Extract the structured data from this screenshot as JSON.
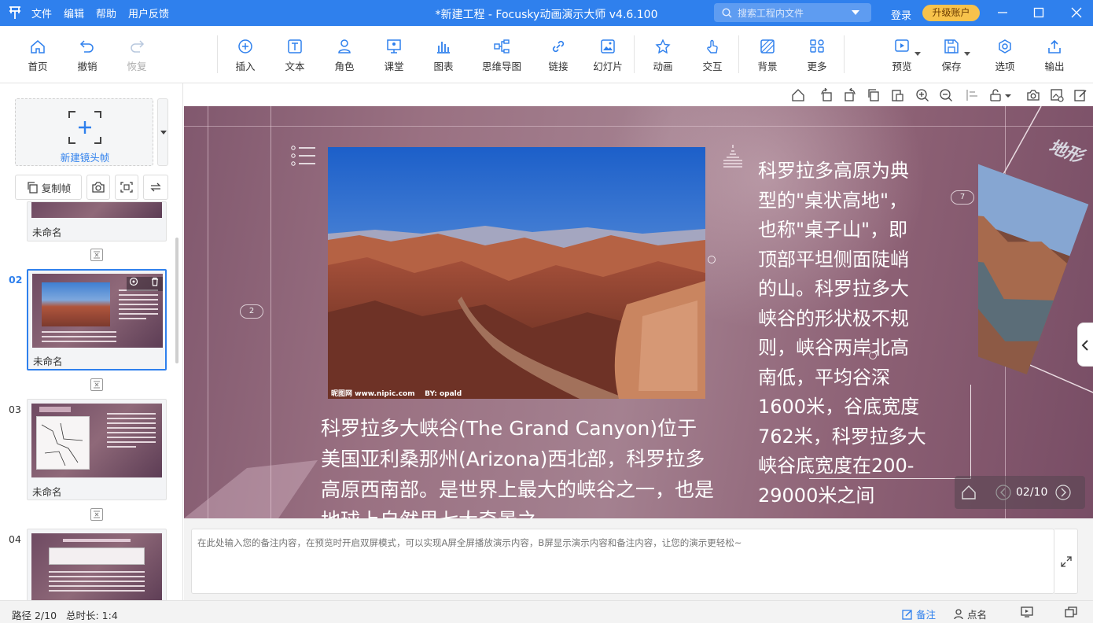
{
  "titlebar": {
    "menu": [
      "文件",
      "编辑",
      "帮助",
      "用户反馈"
    ],
    "title": "*新建工程 - Focusky动画演示大师  v4.6.100",
    "search_placeholder": "搜索工程内文件",
    "login": "登录",
    "upgrade": "升级账户",
    "accent": "#2f80ed"
  },
  "toolbar": {
    "home": "首页",
    "undo": "撤销",
    "redo": "恢复",
    "insert": "插入",
    "text": "文本",
    "role": "角色",
    "classroom": "课堂",
    "chart": "图表",
    "mindmap": "思维导图",
    "link": "链接",
    "slideshow": "幻灯片",
    "animation": "动画",
    "interact": "交互",
    "background": "背景",
    "more": "更多",
    "preview": "预览",
    "save": "保存",
    "options": "选项",
    "export": "输出"
  },
  "leftpanel": {
    "new_frame": "新建镜头帧",
    "copy_frame": "复制帧",
    "slides": [
      {
        "num": "",
        "name": "未命名"
      },
      {
        "num": "02",
        "name": "未命名",
        "selected": true
      },
      {
        "num": "03",
        "name": "未命名"
      },
      {
        "num": "04",
        "name": ""
      }
    ]
  },
  "stage": {
    "body_text": "科罗拉多大峡谷(The Grand Canyon)位于美国亚利桑那州(Arizona)西北部，科罗拉多高原西南部。是世界上最大的峡谷之一，也是地球上自然界七大奇景之",
    "side_text": "科罗拉多高原为典型的\"桌状高地\"，也称\"桌子山\"，即顶部平坦侧面陡峭的山。科罗拉多大峡谷的形状极不规则，峡谷两岸北高南低，平均谷深1600米，谷底宽度762米，科罗拉多大峡谷底宽度在200-29000米之间",
    "photo_watermark_site": "昵图网 www.nipic.com",
    "photo_watermark_by": "BY: opald",
    "frame_badge_left": "2",
    "frame_badge_right": "7",
    "corner_title": "地形",
    "nav_counter": "02/10"
  },
  "notes": {
    "placeholder": "在此处输入您的备注内容，在预览时开启双屏模式，可以实现A屏全屏播放演示内容，B屏显示演示内容和备注内容，让您的演示更轻松~"
  },
  "statusbar": {
    "path": "路径 2/10",
    "duration": "总时长: 1:4",
    "notes": "备注",
    "rollcall": "点名"
  }
}
